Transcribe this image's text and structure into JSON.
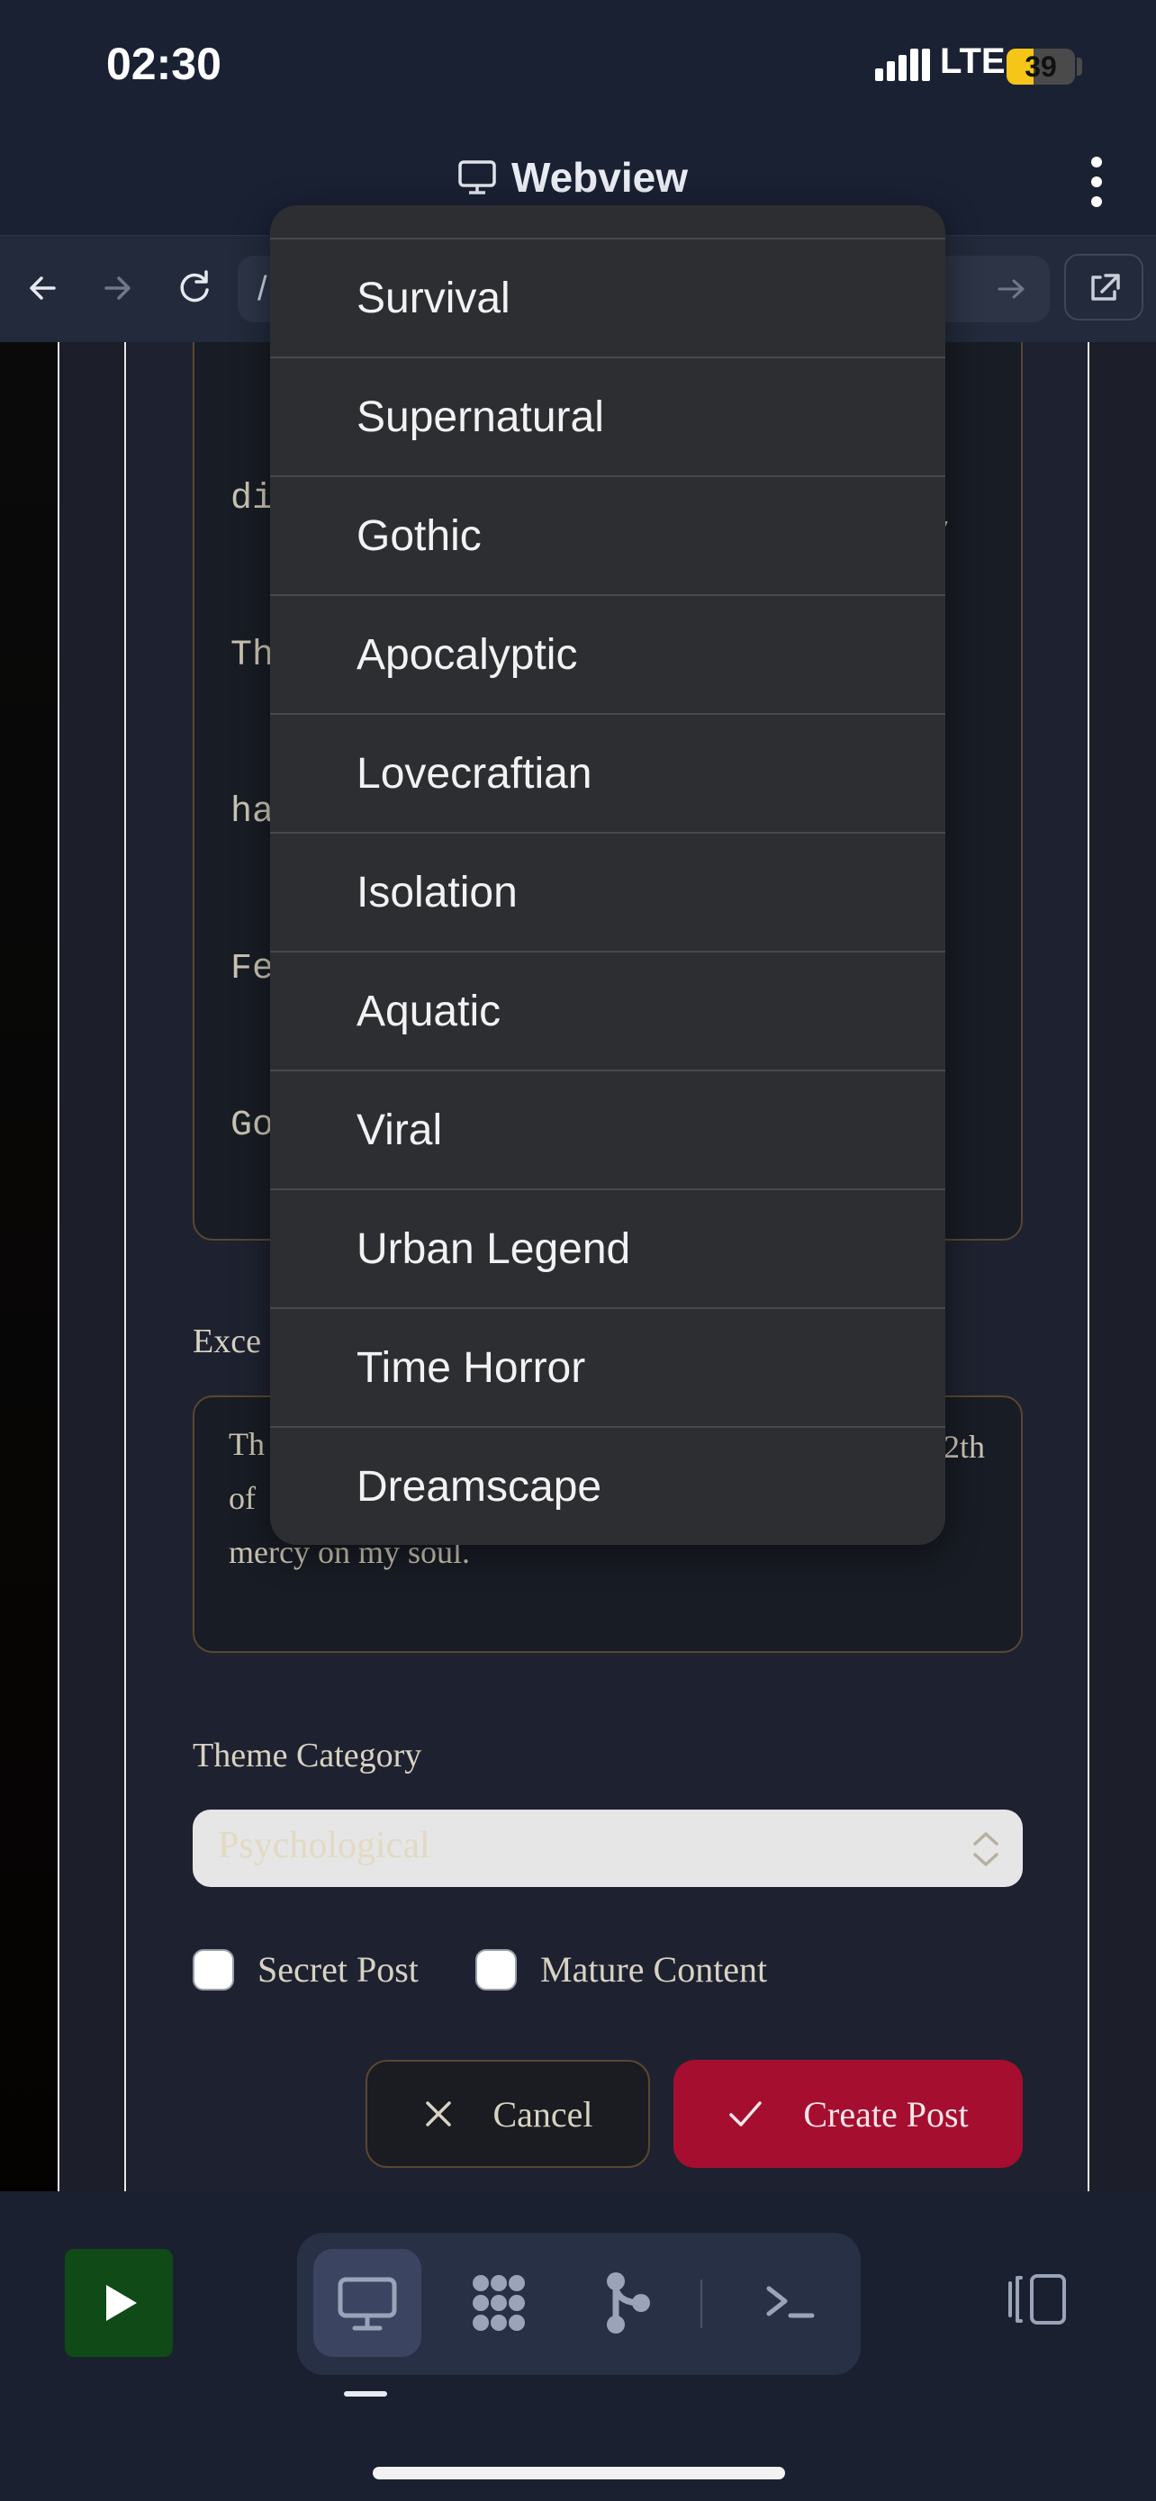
{
  "status_bar": {
    "time": "02:30",
    "network": "LTE",
    "battery": "39",
    "battery_level_percent": 39
  },
  "header": {
    "title": "Webview",
    "icon": "monitor-icon",
    "menu_icon": "kebab-menu-icon"
  },
  "url_bar": {
    "value": "/"
  },
  "story": {
    "lines": [
      "di",
      "Th",
      "ha",
      "Fe",
      "Go"
    ],
    "tail": "y"
  },
  "excerpt": {
    "label": "Exce",
    "lines": [
      "Th",
      "of",
      "mercy on my soul."
    ],
    "tail": "2th"
  },
  "theme": {
    "label": "Theme Category",
    "selected": "Psychological"
  },
  "options": {
    "secret_post": "Secret Post",
    "mature_content": "Mature Content"
  },
  "actions": {
    "cancel": "Cancel",
    "create": "Create Post"
  },
  "dropdown": {
    "items": [
      "Survival",
      "Supernatural",
      "Gothic",
      "Apocalyptic",
      "Lovecraftian",
      "Isolation",
      "Aquatic",
      "Viral",
      "Urban Legend",
      "Time Horror",
      "Dreamscape"
    ]
  },
  "dock": {
    "colors": {
      "play": "#0f4a17",
      "accent_red": "#a60e30"
    }
  }
}
